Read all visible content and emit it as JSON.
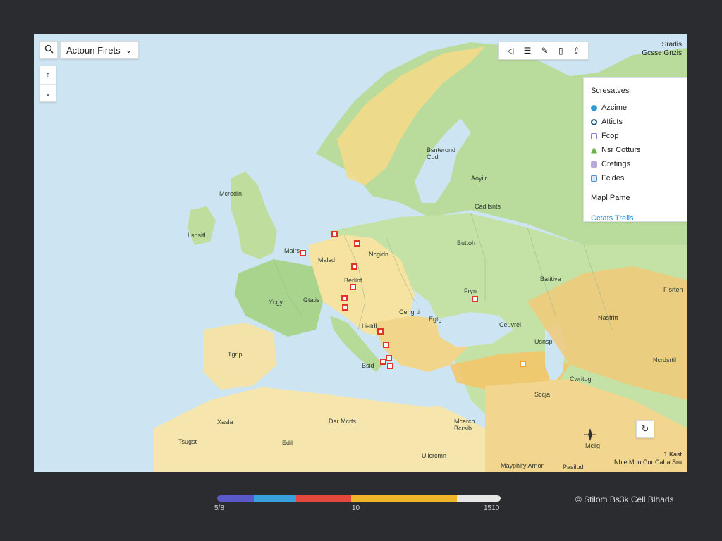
{
  "controls": {
    "search_icon": "search-icon",
    "layer_select": {
      "value": "Actoun Firets"
    },
    "zoom": {
      "up": "↑",
      "down": "⌄"
    },
    "toolbar_icons": [
      "measure-icon",
      "layers-icon",
      "draw-icon",
      "bookmark-icon",
      "share-icon"
    ],
    "locate_icon": "locate-icon"
  },
  "coordinates": {
    "line1": "Sradis",
    "line2": "Gcsse Gnzis"
  },
  "panel": {
    "header": "Scresatves",
    "items": [
      {
        "label": "Azcime",
        "color": "#2f9ad6",
        "icon": "dot-icon"
      },
      {
        "label": "Atticts",
        "color": "#1e5a86",
        "icon": "ring-icon"
      },
      {
        "label": "Fcop",
        "color": "#8f7bc8",
        "icon": "square-icon"
      },
      {
        "label": "Nsr Cotturs",
        "color": "#6ab04c",
        "icon": "tree-icon"
      },
      {
        "label": "Cretings",
        "color": "#b9a7e0",
        "icon": "grid-icon"
      },
      {
        "label": "Fcldes",
        "color": "#4f8fd1",
        "icon": "folder-icon"
      }
    ],
    "map_pane": "Mapl Pame",
    "link": "Cctats Trells"
  },
  "map_labels": [
    {
      "text": "Bsnterond",
      "text2": "Cud"
    },
    {
      "text": "Aoyiir"
    },
    {
      "text": "Cadilsnts"
    },
    {
      "text": "Mcredin"
    },
    {
      "text": "Lsnsitl"
    },
    {
      "text": "Mairs"
    },
    {
      "text": "Ncgidn"
    },
    {
      "text": "Malsd"
    },
    {
      "text": "Berlint"
    },
    {
      "text": "Ycgy"
    },
    {
      "text": "Gtatis"
    },
    {
      "text": "Tgrip"
    },
    {
      "text": "Liatdl"
    },
    {
      "text": "Cengrti"
    },
    {
      "text": "Nasfritt"
    },
    {
      "text": "Buttoh"
    },
    {
      "text": "Egtg"
    },
    {
      "text": "Ceuvrel"
    },
    {
      "text": "Usnsp"
    },
    {
      "text": "Cwritogh"
    },
    {
      "text": "Fisrten"
    },
    {
      "text": "Batitiva"
    },
    {
      "text": "Fryn"
    },
    {
      "text": "Ncrdsrtil"
    },
    {
      "text": "Sccja"
    },
    {
      "text": "Dar Mcrts"
    },
    {
      "text": "Mcerch",
      "text2": "Bcrsib"
    },
    {
      "text": "Ullcrcmn"
    },
    {
      "text": "Mclig"
    },
    {
      "text": "Xasla"
    },
    {
      "text": "Tsugst"
    },
    {
      "text": "Edil"
    },
    {
      "text": "Bsid"
    },
    {
      "text": "Mayphiry Arnon"
    },
    {
      "text": "Pasilud"
    }
  ],
  "scale": {
    "label": "1 Kast",
    "line2": "Nhle Mbu Cnr Caha Sru"
  },
  "legend": {
    "colors": [
      "#5b58c9",
      "#3aa0dd",
      "#e4473b",
      "#f0b429",
      "#e6e6e6"
    ],
    "min": "5/8",
    "mid": "10",
    "max": "1510"
  },
  "attribution": "© Stilom Bs3k Cell Blhads"
}
